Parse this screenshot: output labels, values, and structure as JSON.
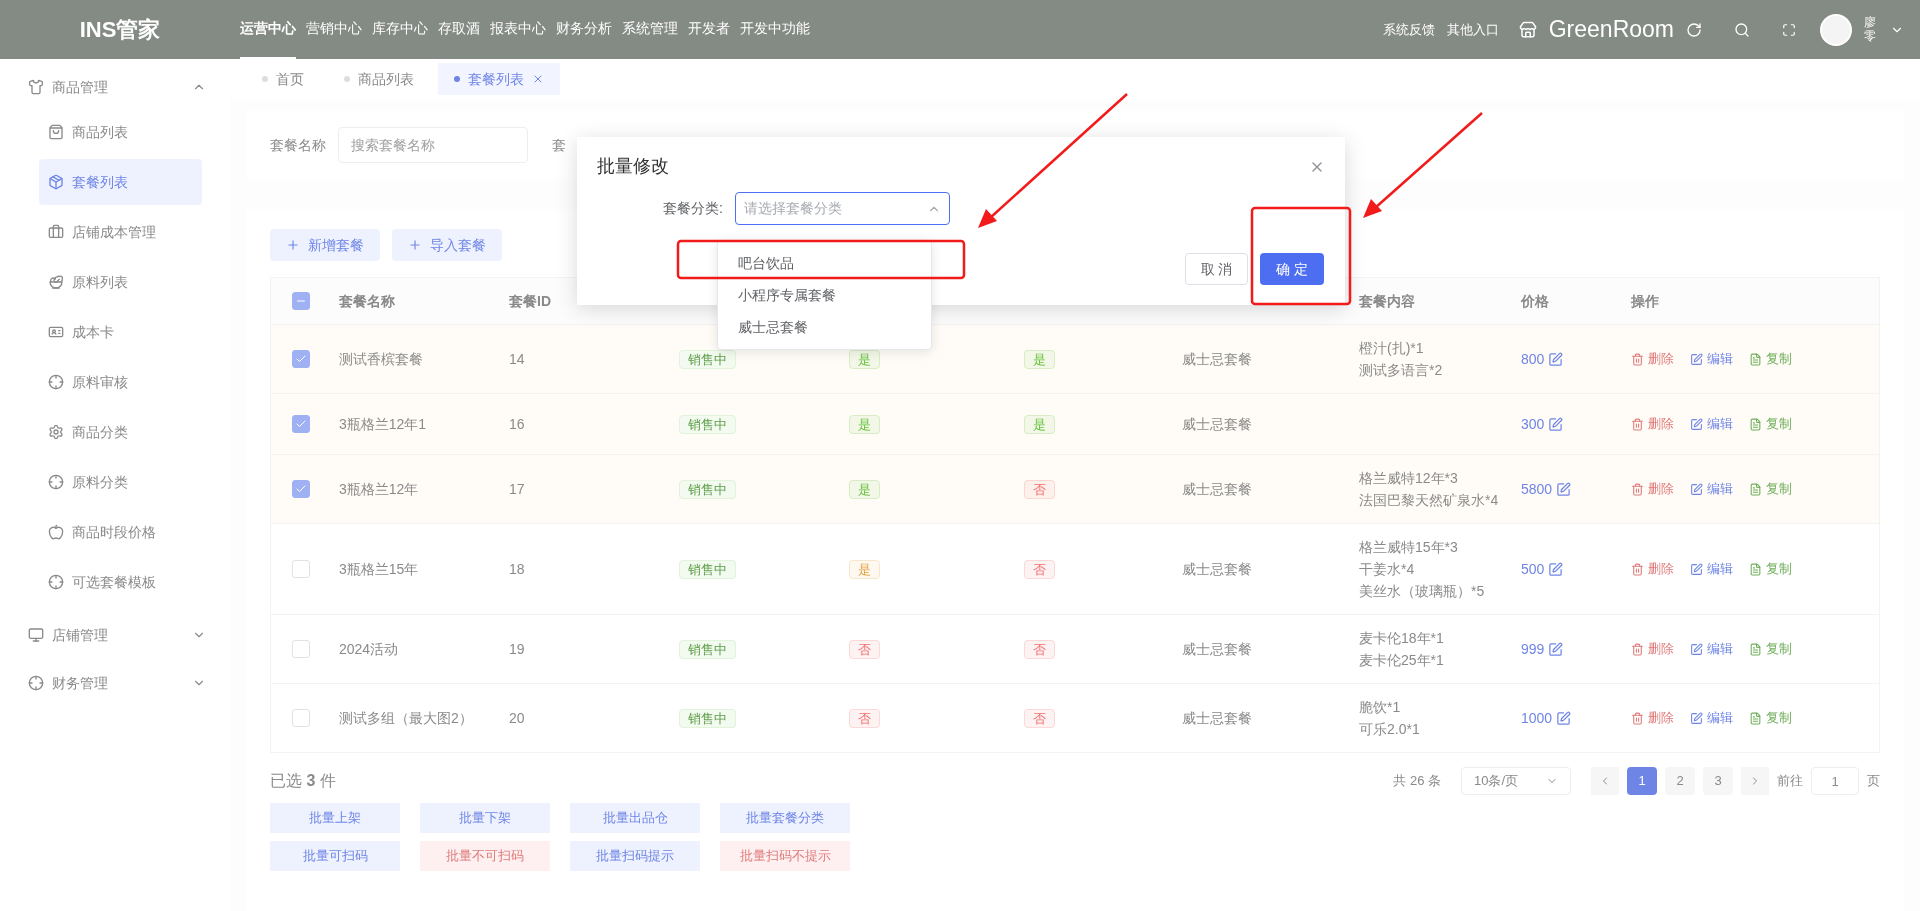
{
  "topbar": {
    "logo": "INS管家",
    "menu": [
      {
        "label": "运营中心",
        "selected": true
      },
      {
        "label": "营销中心",
        "selected": false
      },
      {
        "label": "库存中心",
        "selected": false
      },
      {
        "label": "存取酒",
        "selected": false
      },
      {
        "label": "报表中心",
        "selected": false
      },
      {
        "label": "财务分析",
        "selected": false
      },
      {
        "label": "系统管理",
        "selected": false
      },
      {
        "label": "开发者",
        "selected": false
      },
      {
        "label": "开发中功能",
        "selected": false
      }
    ],
    "links": [
      "系统反馈",
      "其他入口"
    ],
    "store": "GreenRoom",
    "user": "廖零"
  },
  "sidebar": {
    "groups": [
      {
        "label": "商品管理",
        "expanded": true,
        "children": [
          {
            "label": "商品列表",
            "selected": false
          },
          {
            "label": "套餐列表",
            "selected": true
          },
          {
            "label": "店铺成本管理",
            "selected": false
          },
          {
            "label": "原料列表",
            "selected": false
          },
          {
            "label": "成本卡",
            "selected": false
          },
          {
            "label": "原料审核",
            "selected": false
          },
          {
            "label": "商品分类",
            "selected": false
          },
          {
            "label": "原料分类",
            "selected": false
          },
          {
            "label": "商品时段价格",
            "selected": false
          },
          {
            "label": "可选套餐模板",
            "selected": false
          }
        ]
      },
      {
        "label": "店铺管理",
        "expanded": false
      },
      {
        "label": "财务管理",
        "expanded": false
      }
    ]
  },
  "tabs": [
    {
      "label": "首页",
      "selected": false,
      "closable": false
    },
    {
      "label": "商品列表",
      "selected": false,
      "closable": false
    },
    {
      "label": "套餐列表",
      "selected": true,
      "closable": true
    }
  ],
  "filters": [
    {
      "label": "套餐名称",
      "placeholder": "搜索套餐名称"
    },
    {
      "label": "套"
    }
  ],
  "toolbar": [
    "新增套餐",
    "导入套餐"
  ],
  "table": {
    "header_checkbox": {
      "indeterminate": true
    },
    "columns": {
      "name": "套餐名称",
      "id": "套餐ID",
      "contents": "套餐内容",
      "price": "价格",
      "actions": "操作"
    },
    "rows": [
      {
        "selected": true,
        "name": "测试香槟套餐",
        "id": "14",
        "status": "销售中",
        "flag_1": {
          "text": "是",
          "color": "#67c23a"
        },
        "flag_2": {
          "text": "是",
          "color": "#67c23a"
        },
        "category": "威士忌套餐",
        "contents": [
          "橙汁(扎)*1",
          "测试多语言*2"
        ],
        "price": "800",
        "actions": [
          {
            "label": "删除",
            "kind": "delete"
          },
          {
            "label": "编辑",
            "kind": "edit"
          },
          {
            "label": "复制",
            "kind": "copy"
          }
        ]
      },
      {
        "selected": true,
        "name": "3瓶格兰12年1",
        "id": "16",
        "status": "销售中",
        "flag_1": {
          "text": "是",
          "color": "#67c23a"
        },
        "flag_2": {
          "text": "是",
          "color": "#67c23a"
        },
        "category": "威士忌套餐",
        "contents": [],
        "price": "300",
        "actions": [
          {
            "label": "删除",
            "kind": "delete"
          },
          {
            "label": "编辑",
            "kind": "edit"
          },
          {
            "label": "复制",
            "kind": "copy"
          }
        ]
      },
      {
        "selected": true,
        "name": "3瓶格兰12年",
        "id": "17",
        "status": "销售中",
        "flag_1": {
          "text": "是",
          "color": "#67c23a"
        },
        "flag_2": {
          "text": "否",
          "color": "#f56c6c"
        },
        "category": "威士忌套餐",
        "contents": [
          "格兰威特12年*3",
          "法国巴黎天然矿泉水*4"
        ],
        "price": "5800",
        "actions": [
          {
            "label": "删除",
            "kind": "delete"
          },
          {
            "label": "编辑",
            "kind": "edit"
          },
          {
            "label": "复制",
            "kind": "copy"
          }
        ]
      },
      {
        "selected": false,
        "name": "3瓶格兰15年",
        "id": "18",
        "status": "销售中",
        "flag_1": {
          "text": "是",
          "color": "#e6a23c"
        },
        "flag_2": {
          "text": "否",
          "color": "#f56c6c"
        },
        "category": "威士忌套餐",
        "contents": [
          "格兰威特15年*3",
          "干姜水*4",
          "美丝水（玻璃瓶）*5"
        ],
        "price": "500",
        "actions": [
          {
            "label": "删除",
            "kind": "delete"
          },
          {
            "label": "编辑",
            "kind": "edit"
          },
          {
            "label": "复制",
            "kind": "copy"
          }
        ]
      },
      {
        "selected": false,
        "name": "2024活动",
        "id": "19",
        "status": "销售中",
        "flag_1": {
          "text": "否",
          "color": "#f56c6c"
        },
        "flag_2": {
          "text": "否",
          "color": "#f56c6c"
        },
        "category": "威士忌套餐",
        "contents": [
          "麦卡伦18年*1",
          "麦卡伦25年*1"
        ],
        "price": "999",
        "actions": [
          {
            "label": "删除",
            "kind": "delete"
          },
          {
            "label": "编辑",
            "kind": "edit"
          },
          {
            "label": "复制",
            "kind": "copy"
          }
        ]
      },
      {
        "selected": false,
        "name": "测试多组（最大图2）",
        "id": "20",
        "status": "销售中",
        "flag_1": {
          "text": "否",
          "color": "#f56c6c"
        },
        "flag_2": {
          "text": "否",
          "color": "#f56c6c"
        },
        "category": "威士忌套餐",
        "contents": [
          "脆饮*1",
          "可乐2.0*1"
        ],
        "price": "1000",
        "actions": [
          {
            "label": "删除",
            "kind": "delete"
          },
          {
            "label": "编辑",
            "kind": "edit"
          },
          {
            "label": "复制",
            "kind": "copy"
          }
        ]
      }
    ]
  },
  "footer": {
    "selected_count": "已选 **3** 件",
    "total": "共 26 条",
    "page_size": "10条/页",
    "pages": [
      {
        "label": "1",
        "selected": true
      },
      {
        "label": "2",
        "selected": false
      },
      {
        "label": "3",
        "selected": false
      }
    ],
    "goto_label": "前往",
    "goto_value": "1",
    "goto_suffix": "页",
    "batch_buttons": [
      {
        "label": "批量上架",
        "kind": "primary"
      },
      {
        "label": "批量下架",
        "kind": "primary"
      },
      {
        "label": "批量出品仓",
        "kind": "primary"
      },
      {
        "label": "批量套餐分类",
        "kind": "primary"
      },
      {
        "label": "批量可扫码",
        "kind": "primary"
      },
      {
        "label": "批量不可扫码",
        "kind": "danger"
      },
      {
        "label": "批量扫码提示",
        "kind": "primary"
      },
      {
        "label": "批量扫码不提示",
        "kind": "danger"
      }
    ]
  },
  "dialog": {
    "title": "批量修改",
    "field_label": "套餐分类:",
    "placeholder": "请选择套餐分类",
    "options": [
      "吧台饮品",
      "小程序专属套餐",
      "威士忌套餐"
    ],
    "cancel": "取 消",
    "confirm": "确 定"
  }
}
